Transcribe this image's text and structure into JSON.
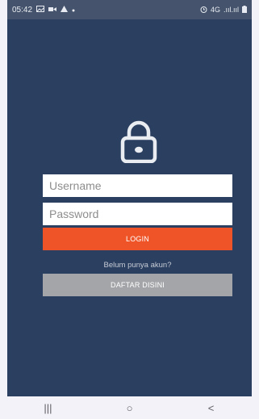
{
  "status_bar": {
    "time": "05:42",
    "left_icons": [
      "gallery-icon",
      "video-icon",
      "alert-icon",
      "dot-icon"
    ],
    "right_icons": [
      "alarm-icon",
      "network-icon",
      "signal-icon",
      "battery-icon"
    ],
    "network_text": "4G",
    "signal_text": ".ııl.ııl"
  },
  "login": {
    "lock_icon": "lock-icon",
    "username_placeholder": "Username",
    "password_placeholder": "Password",
    "login_label": "LOGIN",
    "no_account_text": "Belum punya akun?",
    "register_label": "DAFTAR DISINI"
  },
  "nav_bar": {
    "recents": "|||",
    "home": "○",
    "back": "<"
  },
  "colors": {
    "background": "#2b3f60",
    "login_button": "#ee5427",
    "register_button": "#a3a5a8",
    "field": "#ffffff"
  }
}
